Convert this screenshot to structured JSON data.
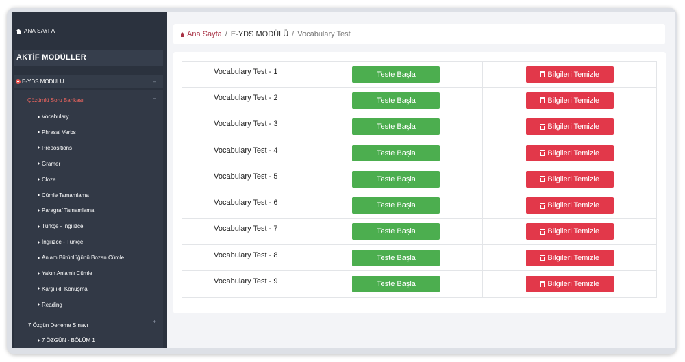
{
  "sidebar": {
    "home_label": "ANA SAYFA",
    "section_title": "AKTİF MODÜLLER",
    "module_label": "E-YDS MODÜLÜ",
    "module_toggle": "–",
    "submenu_label": "Çözümlü Soru Bankası",
    "submenu_toggle": "–",
    "items": [
      {
        "label": "Vocabulary"
      },
      {
        "label": "Phrasal Verbs"
      },
      {
        "label": "Prepositions"
      },
      {
        "label": "Gramer"
      },
      {
        "label": "Cloze"
      },
      {
        "label": "Cümle Tamamlama"
      },
      {
        "label": "Paragraf Tamamlama"
      },
      {
        "label": "Türkçe - İngilizce"
      },
      {
        "label": "İngilizce - Türkçe"
      },
      {
        "label": "Anlam Bütünlüğünü Bozan Cümle"
      },
      {
        "label": "Yakın Anlamlı Cümle"
      },
      {
        "label": "Karşılıklı Konuşma"
      },
      {
        "label": "Reading"
      }
    ],
    "exam_label": "7 Özgün Deneme Sınavı",
    "exam_toggle": "+",
    "exam_item": "7 ÖZGÜN - BÖLÜM 1"
  },
  "breadcrumb": {
    "home": "Ana Sayfa",
    "sep": "/",
    "module": "E-YDS MODÜLÜ",
    "current": "Vocabulary Test"
  },
  "tests": [
    {
      "name": "Vocabulary Test - 1",
      "start_label": "Teste Başla",
      "clear_label": "Bilgileri Temizle"
    },
    {
      "name": "Vocabulary Test - 2",
      "start_label": "Teste Başla",
      "clear_label": "Bilgileri Temizle"
    },
    {
      "name": "Vocabulary Test - 3",
      "start_label": "Teste Başla",
      "clear_label": "Bilgileri Temizle"
    },
    {
      "name": "Vocabulary Test - 4",
      "start_label": "Teste Başla",
      "clear_label": "Bilgileri Temizle"
    },
    {
      "name": "Vocabulary Test - 5",
      "start_label": "Teste Başla",
      "clear_label": "Bilgileri Temizle"
    },
    {
      "name": "Vocabulary Test - 6",
      "start_label": "Teste Başla",
      "clear_label": "Bilgileri Temizle"
    },
    {
      "name": "Vocabulary Test - 7",
      "start_label": "Teste Başla",
      "clear_label": "Bilgileri Temizle"
    },
    {
      "name": "Vocabulary Test - 8",
      "start_label": "Teste Başla",
      "clear_label": "Bilgileri Temizle"
    },
    {
      "name": "Vocabulary Test - 9",
      "start_label": "Teste Başla",
      "clear_label": "Bilgileri Temizle"
    }
  ],
  "colors": {
    "sidebar_bg": "#2b323e",
    "accent_red": "#e2384a",
    "accent_green": "#4cae4f",
    "breadcrumb_link": "#a83245"
  }
}
